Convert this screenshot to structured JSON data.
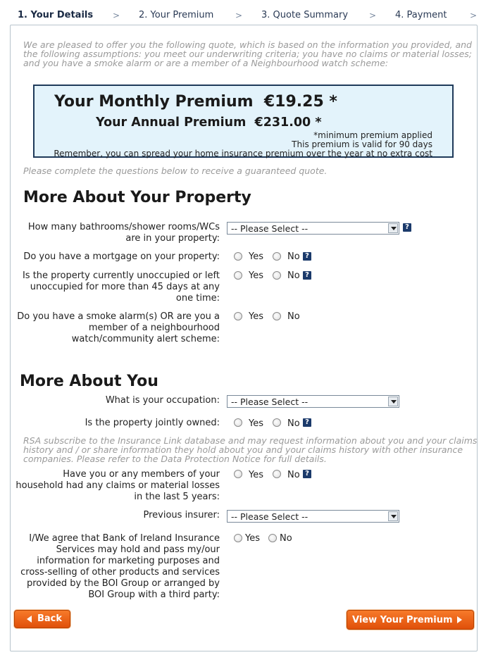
{
  "steps": [
    {
      "label": "1. Your Details",
      "active": true
    },
    {
      "label": "2. Your Premium",
      "active": false
    },
    {
      "label": "3. Quote Summary",
      "active": false
    },
    {
      "label": "4. Payment",
      "active": false
    }
  ],
  "step_separator": ">",
  "intro": "We are pleased to offer you the following quote, which is based on the information you provided, and the following assumptions: you meet our underwriting criteria; you have no claims or material losses; and you have a smoke alarm or are a member of a Neighbourhood watch scheme:",
  "premium": {
    "monthly_label": "Your Monthly Premium",
    "monthly_value": "€19.25 *",
    "annual_label": "Your Annual Premium",
    "annual_value": "€231.00 *",
    "note_min": "*minimum premium applied",
    "note_valid": "This premium is valid for 90 days",
    "note_spread": "Remember, you can spread your home insurance premium over the year at no extra cost"
  },
  "hint": "Please complete the questions below to receive a guaranteed quote.",
  "property": {
    "heading": "More About Your Property",
    "q_bathrooms": "How many bathrooms/shower rooms/WCs are in your property:",
    "q_bathrooms_value": "-- Please Select --",
    "q_mortgage": "Do you have a mortgage on your property:",
    "q_unoccupied": "Is the property currently unoccupied or left unoccupied for more than 45 days at any one time:",
    "q_smoke": "Do you have a smoke alarm(s) OR are you a member of a neighbourhood watch/community alert scheme:"
  },
  "you": {
    "heading": "More About You",
    "q_occupation": "What is your occupation:",
    "q_occupation_value": "-- Please Select --",
    "q_joint": "Is the property jointly owned:",
    "rsa_note": "RSA subscribe to the Insurance Link database and may request information about you and your claims history and / or share information they hold about you and your claims history with other insurance companies. Please refer to the Data Protection Notice for full details.",
    "q_claims": "Have you or any members of your household had any claims or material losses in the last 5 years:",
    "q_insurer": "Previous insurer:",
    "q_insurer_value": "-- Please Select --",
    "q_consent": "I/We agree that Bank of Ireland Insurance Services may hold and pass my/our information for marketing purposes and cross-selling of other products and services provided by the BOI Group or arranged by BOI Group with a third party:"
  },
  "radio": {
    "yes": "Yes",
    "no": "No"
  },
  "help_glyph": "?",
  "buttons": {
    "back": "Back",
    "view": "View Your Premium"
  },
  "colors": {
    "accent_orange": "#e8600f",
    "help_blue": "#1b3a6b",
    "premium_bg": "#e3f3fb"
  }
}
